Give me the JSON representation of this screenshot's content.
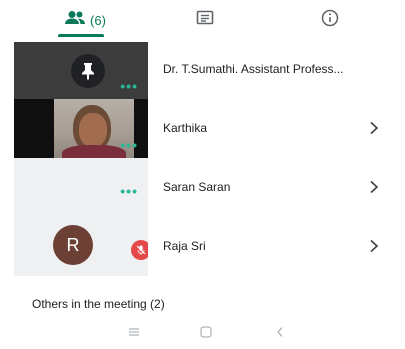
{
  "tabs": {
    "people": {
      "icon": "people-icon",
      "count": "(6)",
      "active": true
    },
    "chat": {
      "icon": "chat-icon"
    },
    "info": {
      "icon": "info-icon"
    }
  },
  "colors": {
    "accent": "#0b7a5a",
    "dots": "#2ab795",
    "mute_badge": "#e54848",
    "avatar_bg": "#6d4036"
  },
  "participants": [
    {
      "name": "Dr. T.Sumathi. Assistant Profess...",
      "tile": "pinned",
      "icon": "pin-icon",
      "chevron": false
    },
    {
      "name": "Karthika",
      "tile": "video",
      "chevron": true
    },
    {
      "name": "Saran Saran",
      "tile": "blank",
      "chevron": true
    },
    {
      "name": "Raja Sri",
      "tile": "avatar",
      "avatar_letter": "R",
      "muted": true,
      "chevron": true
    }
  ],
  "others_section": {
    "title": "Others in the meeting (2)"
  },
  "system_nav": {
    "menu": "menu-icon",
    "home": "home-icon",
    "back": "back-icon"
  }
}
